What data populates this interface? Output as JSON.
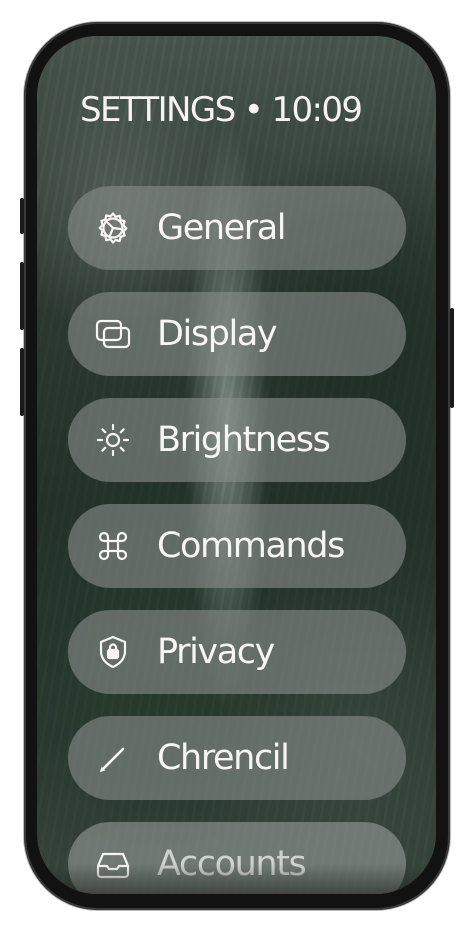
{
  "header": {
    "title": "SETTINGS • 10:09"
  },
  "menu": {
    "items": [
      {
        "label": "General",
        "icon": "gear-icon"
      },
      {
        "label": "Display",
        "icon": "display-windows-icon"
      },
      {
        "label": "Brightness",
        "icon": "sun-icon"
      },
      {
        "label": "Commands",
        "icon": "command-key-icon"
      },
      {
        "label": "Privacy",
        "icon": "shield-lock-icon"
      },
      {
        "label": "Chrencil",
        "icon": "pencil-icon"
      },
      {
        "label": "Accounts",
        "icon": "inbox-tray-icon"
      }
    ]
  },
  "colors": {
    "text": "#f6f6f6",
    "pill": "#8a908c",
    "frame": "#121212"
  }
}
